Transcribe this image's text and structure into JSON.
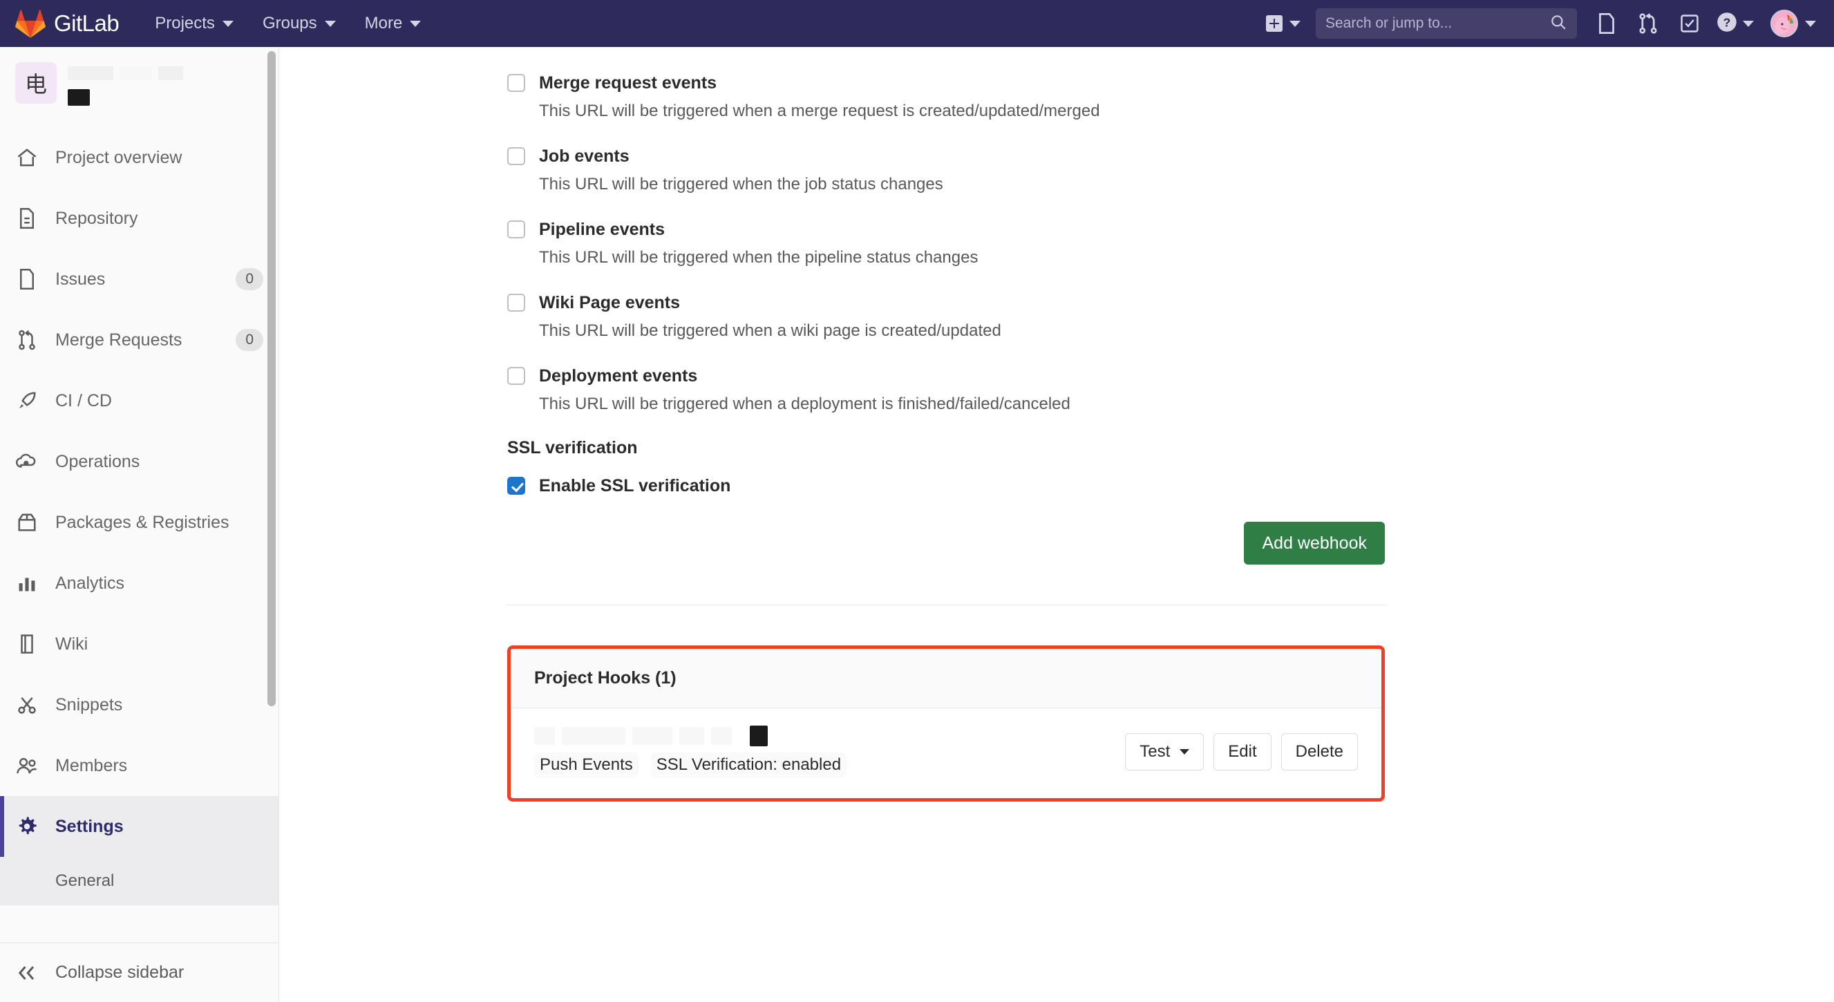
{
  "navbar": {
    "brand": "GitLab",
    "items": [
      {
        "label": "Projects",
        "icon": "chevron-down-icon"
      },
      {
        "label": "Groups",
        "icon": "chevron-down-icon"
      },
      {
        "label": "More",
        "icon": "chevron-down-icon"
      }
    ],
    "search": {
      "placeholder": "Search or jump to...",
      "value": "",
      "icon": "search-icon"
    },
    "icons": [
      "plus-icon",
      "issues-icon",
      "merge-request-icon",
      "todos-icon",
      "help-icon",
      "avatar"
    ],
    "colors": {
      "background": "#2e2a5b",
      "search_bg": "#45406b"
    }
  },
  "sidebar": {
    "project_avatar_char": "电",
    "items": [
      {
        "label": "Project overview",
        "icon": "home-icon",
        "badge": ""
      },
      {
        "label": "Repository",
        "icon": "document-icon",
        "badge": ""
      },
      {
        "label": "Issues",
        "icon": "issues-icon",
        "badge": "0"
      },
      {
        "label": "Merge Requests",
        "icon": "merge-request-icon",
        "badge": "0"
      },
      {
        "label": "CI / CD",
        "icon": "rocket-icon",
        "badge": ""
      },
      {
        "label": "Operations",
        "icon": "cloud-gear-icon",
        "badge": ""
      },
      {
        "label": "Packages & Registries",
        "icon": "package-icon",
        "badge": ""
      },
      {
        "label": "Analytics",
        "icon": "chart-icon",
        "badge": ""
      },
      {
        "label": "Wiki",
        "icon": "book-icon",
        "badge": ""
      },
      {
        "label": "Snippets",
        "icon": "snippet-icon",
        "badge": ""
      },
      {
        "label": "Members",
        "icon": "users-icon",
        "badge": ""
      },
      {
        "label": "Settings",
        "icon": "gear-icon",
        "badge": "",
        "active": true
      }
    ],
    "sub_item": "General",
    "collapse_label": "Collapse sidebar",
    "collapse_icon": "double-chevron-left-icon"
  },
  "main": {
    "events": [
      {
        "label": "Merge request events",
        "description": "This URL will be triggered when a merge request is created/updated/merged",
        "checked": false
      },
      {
        "label": "Job events",
        "description": "This URL will be triggered when the job status changes",
        "checked": false
      },
      {
        "label": "Pipeline events",
        "description": "This URL will be triggered when the pipeline status changes",
        "checked": false
      },
      {
        "label": "Wiki Page events",
        "description": "This URL will be triggered when a wiki page is created/updated",
        "checked": false
      },
      {
        "label": "Deployment events",
        "description": "This URL will be triggered when a deployment is finished/failed/canceled",
        "checked": false
      }
    ],
    "ssl_section_title": "SSL verification",
    "ssl_checkbox_label": "Enable SSL verification",
    "ssl_checked": true,
    "add_webhook_label": "Add webhook",
    "hooks": {
      "title": "Project Hooks (1)",
      "rows": [
        {
          "url": "",
          "badges": [
            "Push Events",
            "SSL Verification: enabled"
          ],
          "actions": [
            {
              "label": "Test",
              "has_caret": true
            },
            {
              "label": "Edit",
              "has_caret": false
            },
            {
              "label": "Delete",
              "has_caret": false
            }
          ]
        }
      ],
      "highlight_color": "#ef3f26"
    }
  }
}
